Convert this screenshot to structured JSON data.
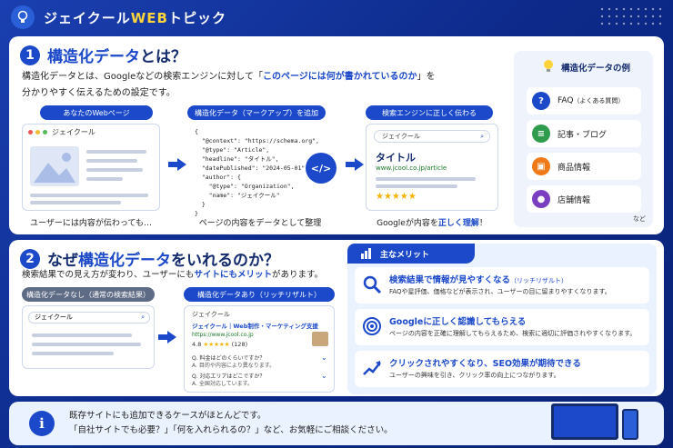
{
  "header": {
    "title_prefix": "ジェイクール",
    "title_highlight": "WEB",
    "title_suffix": "トピック"
  },
  "section1": {
    "number": "1",
    "title_blue": "構造化データ",
    "title_rest": "とは？",
    "lead_line1_a": "構造化データとは、Googleなどの検索エンジンに対して「",
    "lead_line1_hl": "このページには何が書かれているのか",
    "lead_line1_b": "」を",
    "lead_line2": "分かりやすく伝えるための設定です。",
    "step1": {
      "label": "あなたのWebページ",
      "site_name": "ジェイクール",
      "caption": "ユーザーには内容が伝わっても…"
    },
    "step2": {
      "label": "構造化データ（マークアップ）を追加",
      "caption": "ページの内容をデータとして整理",
      "code": "{\n  \"@context\": \"https://schema.org\",\n  \"@type\": \"Article\",\n  \"headline\": \"タイトル\",\n  \"datePublished\": \"2024-05-01\",\n  \"author\": {\n    \"@type\": \"Organization\",\n    \"name\": \"ジェイクール\"\n  }\n}",
      "badge": "</>"
    },
    "step3": {
      "label": "検索エンジンに正しく伝わる",
      "search_text": "ジェイクール",
      "result_title": "タイトル",
      "result_url": "www.jcool.co.jp/article",
      "caption_a": "Googleが内容を",
      "caption_hl": "正しく理解",
      "caption_b": "！"
    },
    "examples": {
      "title": "構造化データの例",
      "items": [
        {
          "icon": "?",
          "label": "FAQ",
          "sub": "（よくある質問）",
          "color": "#1b49c9"
        },
        {
          "icon": "≡",
          "label": "記事・ブログ",
          "sub": "",
          "color": "#2e9b4d"
        },
        {
          "icon": "▣",
          "label": "商品情報",
          "sub": "",
          "color": "#f07a1a"
        },
        {
          "icon": "●",
          "label": "店舗情報",
          "sub": "",
          "color": "#7a3fc0"
        }
      ],
      "more": "など"
    }
  },
  "section2": {
    "number": "2",
    "title_a": "なぜ",
    "title_blue": "構造化データ",
    "title_b": "をいれるのか？",
    "lead_a": "検索結果での見え方が変わり、ユーザーにも",
    "lead_hl": "サイトにもメリット",
    "lead_b": "があります。",
    "before": {
      "label": "構造化データなし（通常の検索結果）",
      "search_text": "ジェイクール"
    },
    "after": {
      "label": "構造化データあり（リッチリザルト）",
      "search_text": "ジェイクール",
      "result_title": "ジェイクール｜Web制作・マーケティング支援",
      "url": "https://www.jcool.co.jp",
      "rating": "4.8",
      "stars": "★★★★★",
      "reviews": "(128)",
      "faq": [
        {
          "q": "Q.  料金はどのくらいですか？",
          "a": "A.  目的や内容により異なります。"
        },
        {
          "q": "Q.  対応エリアはどこですか？",
          "a": "A.  全国対応しています。"
        }
      ]
    },
    "merits": {
      "title": "主なメリット",
      "items": [
        {
          "title": "検索結果で情報が見やすくなる",
          "sub": "（リッチリザルト）",
          "desc": "FAQや星評価、価格などが表示され、ユーザーの目に留まりやすくなります。"
        },
        {
          "title": "Googleに正しく認識してもらえる",
          "sub": "",
          "desc": "ページの内容を正確に理解してもらえるため、検索に適切に評価されやすくなります。"
        },
        {
          "title": "クリックされやすくなり、SEO効果が期待できる",
          "sub": "",
          "desc": "ユーザーの興味を引き、クリック率の向上につながります。"
        }
      ]
    }
  },
  "footer": {
    "icon": "i",
    "line1": "既存サイトにも追加できるケースがほとんどです。",
    "line2": "「自社サイトでも必要？」「何を入れられるの？」など、お気軽にご相談ください。"
  }
}
